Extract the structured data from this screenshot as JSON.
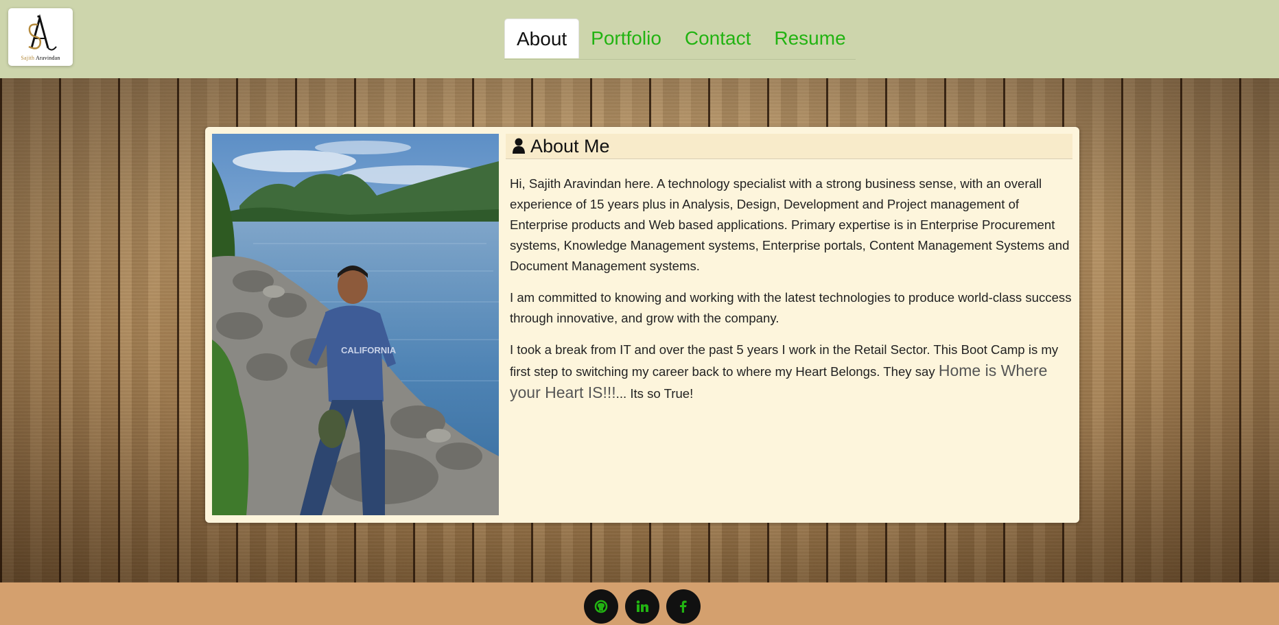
{
  "logo": {
    "monogram": "SA",
    "first_name": "Sajith",
    "last_name": "Aravindan"
  },
  "nav": {
    "items": [
      {
        "label": "About",
        "active": true
      },
      {
        "label": "Portfolio",
        "active": false
      },
      {
        "label": "Contact",
        "active": false
      },
      {
        "label": "Resume",
        "active": false
      }
    ]
  },
  "about": {
    "icon": "user-icon",
    "title": "About Me",
    "paragraph1": "Hi, Sajith Aravindan here. A technology specialist with a strong business sense, with an overall experience of 15 years plus in Analysis, Design, Development and Project management of Enterprise products and Web based applications. Primary expertise is in Enterprise Procurement systems, Knowledge Management systems, Enterprise portals, Content Management Systems and Document Management systems.",
    "paragraph2": "I am committed to knowing and working with the latest technologies to produce world-class success through innovative, and grow with the company.",
    "paragraph3_start": "I took a break from IT and over the past 5 years I work in the Retail Sector. This Boot Camp is my first step to switching my career back to where my Heart Belongs. They say ",
    "paragraph3_highlight": "Home is Where your Heart IS!!!",
    "paragraph3_end": "... Its so True!"
  },
  "footer": {
    "social": [
      {
        "icon": "github-icon"
      },
      {
        "icon": "linkedin-icon"
      },
      {
        "icon": "facebook-icon"
      }
    ]
  },
  "colors": {
    "header_bg": "#cdd5ac",
    "nav_link": "#22b312",
    "card_bg": "#fdf5dc",
    "card_header_bg": "#f8ebca",
    "footer_bg": "#d4a06e",
    "social_icon": "#22b312"
  }
}
